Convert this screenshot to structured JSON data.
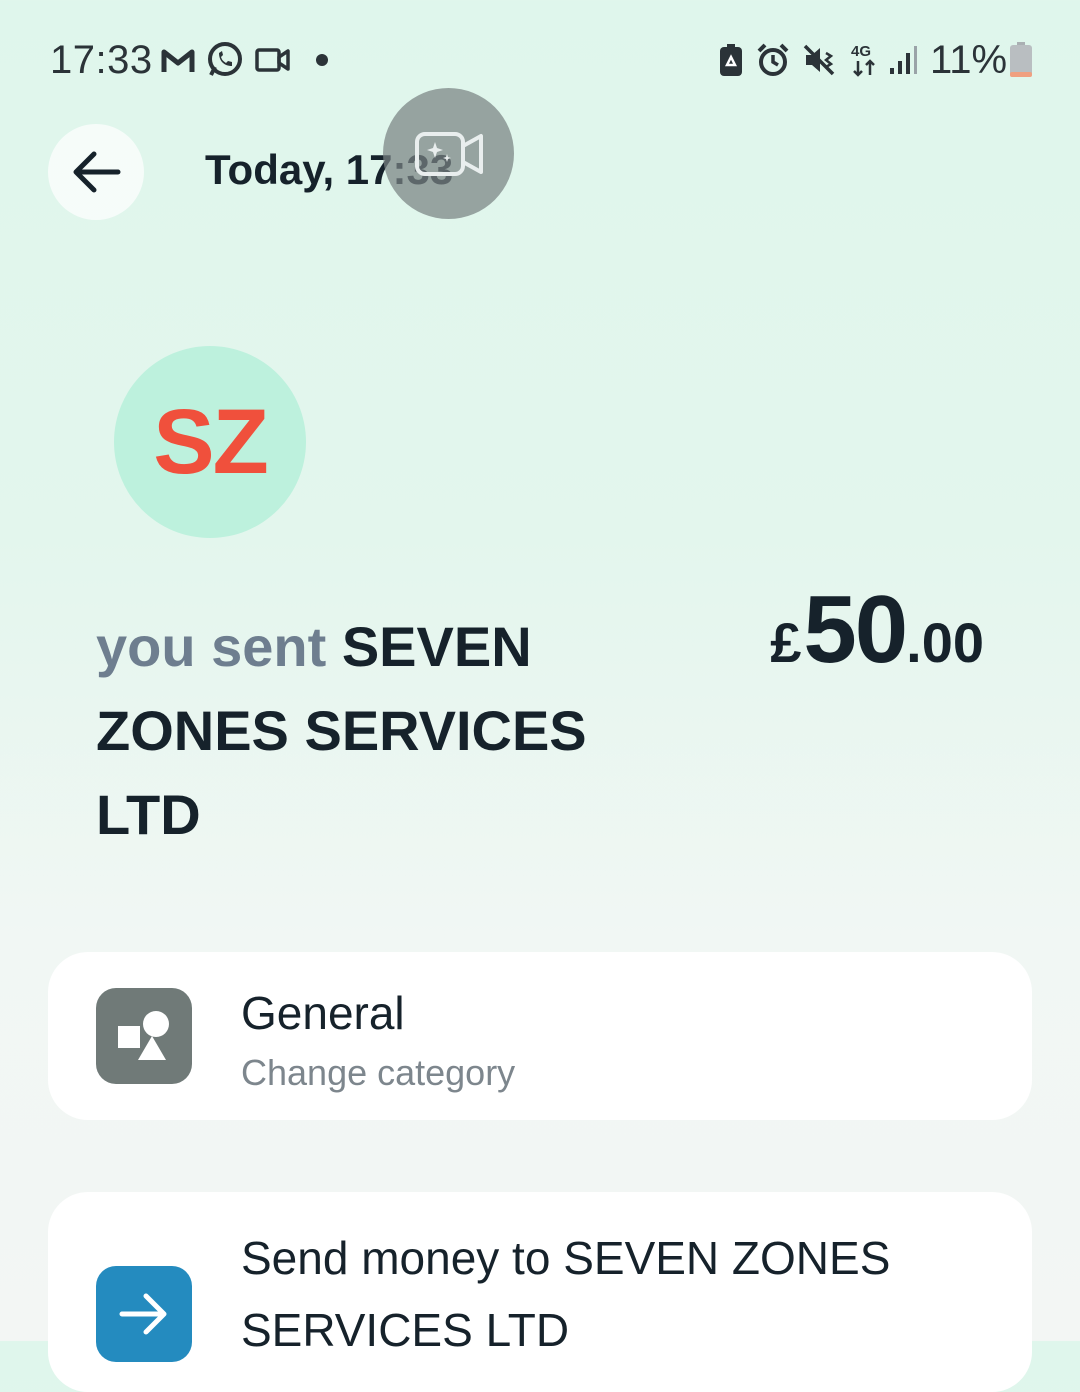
{
  "status_bar": {
    "time": "17:33",
    "notification_icons": [
      "gmail-icon",
      "whatsapp-icon",
      "video-camera-icon",
      "dot-icon"
    ],
    "system_icons": [
      "battery-saver-icon",
      "alarm-icon",
      "vibrate-mute-icon",
      "network-4g-icon",
      "signal-icon"
    ],
    "battery_percent": "11%",
    "battery_level": 0.11
  },
  "header": {
    "back_icon": "arrow-left-icon",
    "title": "Today, 17:33",
    "overlay_icon": "screen-recorder-icon"
  },
  "transaction": {
    "avatar_initials": "SZ",
    "prefix": "you sent",
    "recipient": "SEVEN ZONES SERVICES LTD",
    "amount_currency": "£",
    "amount_major": "50",
    "amount_minor": ".00"
  },
  "category_card": {
    "icon": "shapes-icon",
    "title": "General",
    "subtitle": "Change category"
  },
  "send_card": {
    "icon": "arrow-right-icon",
    "title": "Send money to SEVEN ZONES SERVICES LTD"
  },
  "colors": {
    "accent_avatar_bg": "#bdf1dd",
    "avatar_text": "#f0503c",
    "category_icon_bg": "#707a78",
    "send_icon_bg": "#248bbf",
    "battery_low": "#f0a080"
  }
}
